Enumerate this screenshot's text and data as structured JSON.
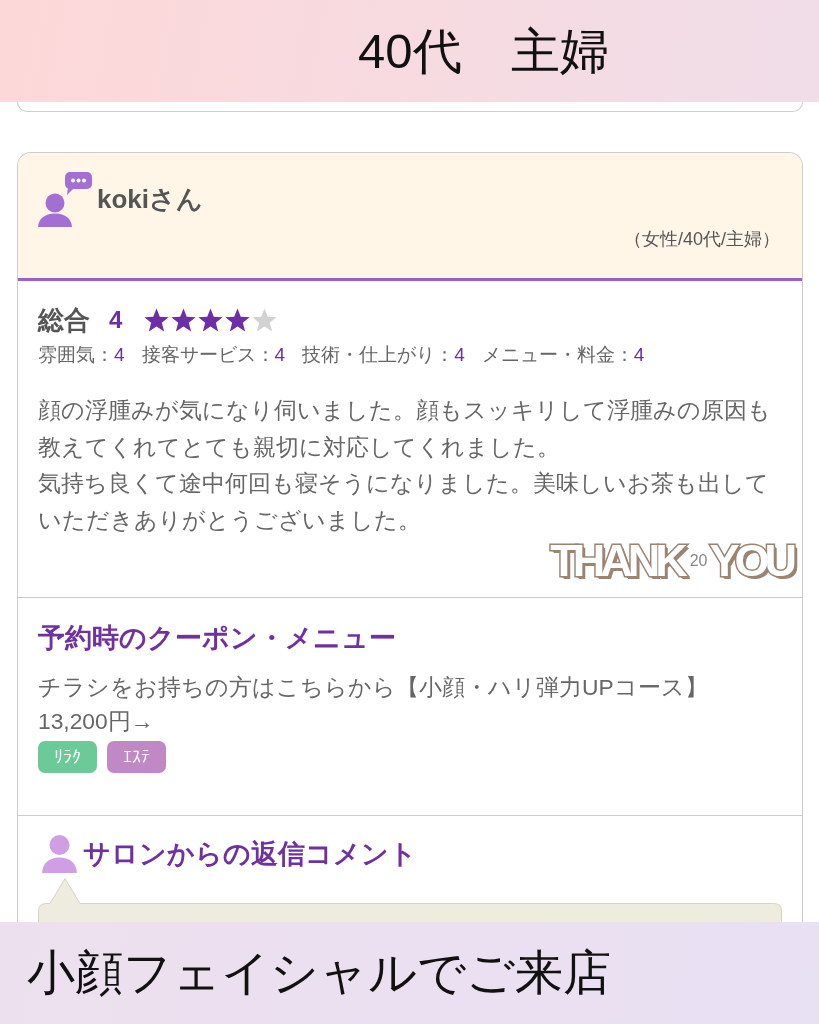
{
  "banner_top": {
    "text": "40代　主婦"
  },
  "review": {
    "reviewer": {
      "name": "kokiさん",
      "profile": "（女性/40代/主婦）"
    },
    "overall": {
      "label": "総合",
      "score": "4",
      "stars": 4
    },
    "sub_ratings": [
      {
        "label": "雰囲気：",
        "score": "4"
      },
      {
        "label": "接客サービス：",
        "score": "4"
      },
      {
        "label": "技術・仕上がり：",
        "score": "4"
      },
      {
        "label": "メニュー・料金：",
        "score": "4"
      }
    ],
    "comment": [
      "顔の浮腫みが気になり伺いました。顔もスッキリして浮腫みの原因も教えてくれてとても親切に対応してくれました。",
      "気持ち良くて途中何回も寝そうになりました。美味しいお茶も出していただきありがとうございました。"
    ],
    "sticker_first": "THANK",
    "date": "20",
    "sticker_second": "YOU"
  },
  "coupon": {
    "heading": "予約時のクーポン・メニュー",
    "name": "チラシをお持ちの方はこちらから【小顔・ハリ弾力UPコース】",
    "price": "13,200円→",
    "tags": [
      {
        "label": "ﾘﾗｸ",
        "color": "#6cc998"
      },
      {
        "label": "ｴｽﾃ",
        "color": "#c088c4"
      }
    ]
  },
  "salon_reply": {
    "heading": "サロンからの返信コメント"
  },
  "banner_bottom": {
    "text": "小顔フェイシャルでご来店"
  }
}
